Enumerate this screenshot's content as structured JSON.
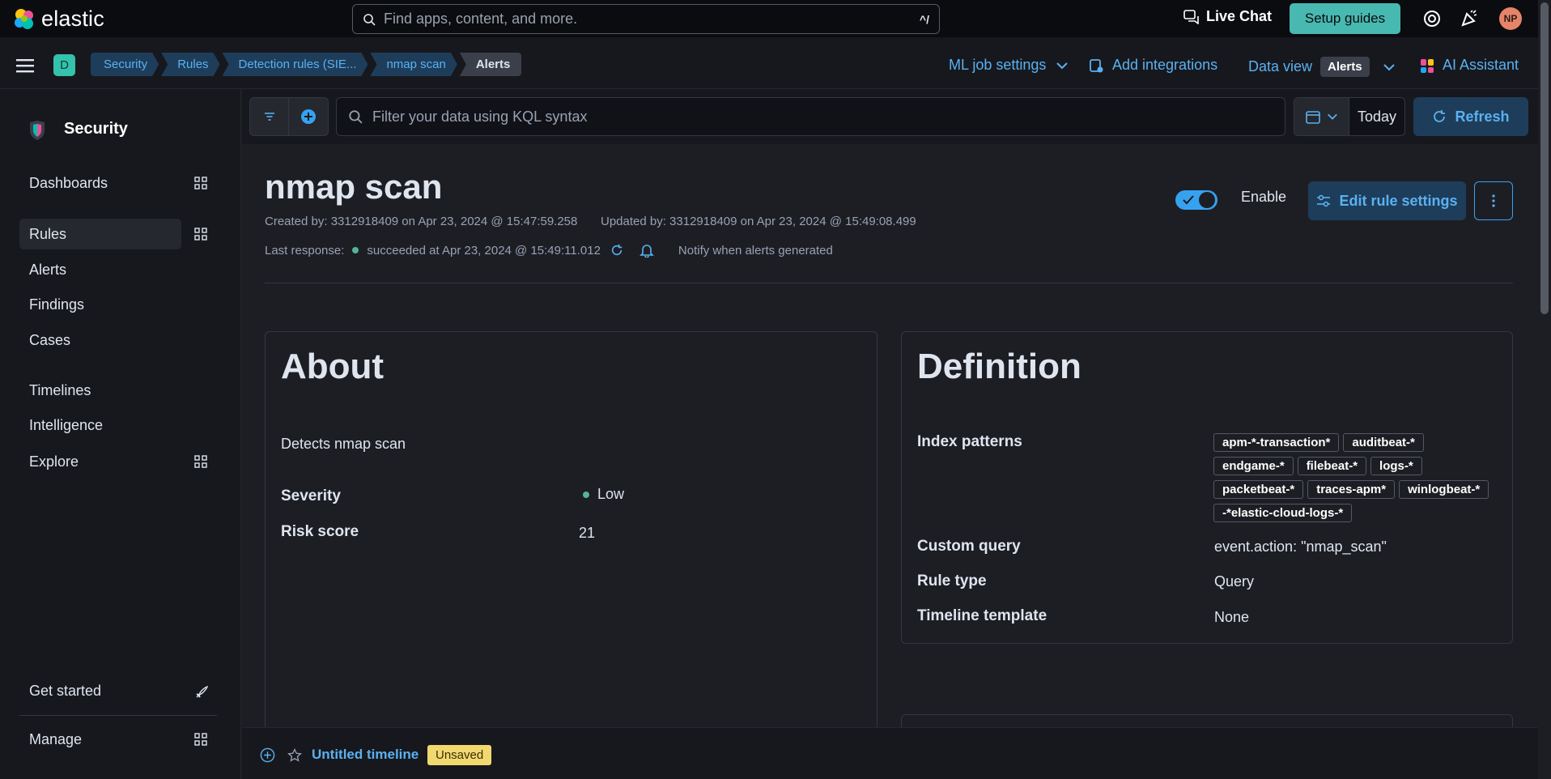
{
  "topbar": {
    "logo_text": "elastic",
    "search_placeholder": "Find apps, content, and more.",
    "search_shortcut": "^/",
    "live_chat": "Live Chat",
    "setup_guides": "Setup guides",
    "avatar_initials": "NP"
  },
  "breadcrumbs": [
    "Security",
    "Rules",
    "Detection rules (SIE...",
    "nmap scan",
    "Alerts"
  ],
  "space_badge": "D",
  "header_actions": {
    "ml_job_settings": "ML job settings",
    "add_integrations": "Add integrations",
    "data_view_label": "Data view",
    "data_view_value": "Alerts",
    "ai_assistant": "AI Assistant"
  },
  "sidebar": {
    "title": "Security",
    "items": {
      "dashboards": "Dashboards",
      "rules": "Rules",
      "alerts": "Alerts",
      "findings": "Findings",
      "cases": "Cases",
      "timelines": "Timelines",
      "intelligence": "Intelligence",
      "explore": "Explore",
      "get_started": "Get started",
      "manage": "Manage"
    }
  },
  "querybar": {
    "placeholder": "Filter your data using KQL syntax",
    "date": "Today",
    "refresh": "Refresh"
  },
  "rule": {
    "title": "nmap scan",
    "created": "Created by: 3312918409 on Apr 23, 2024 @ 15:47:59.258",
    "updated": "Updated by: 3312918409 on Apr 23, 2024 @ 15:49:08.499",
    "last_response_label": "Last response:",
    "last_response_value": "succeeded at Apr 23, 2024 @ 15:49:11.012",
    "notify": "Notify when alerts generated",
    "enable_label": "Enable",
    "enabled": true,
    "edit_button": "Edit rule settings"
  },
  "about": {
    "title": "About",
    "description": "Detects nmap scan",
    "severity_label": "Severity",
    "severity_value": "Low",
    "severity_color": "#54b399",
    "risk_label": "Risk score",
    "risk_value": "21"
  },
  "definition": {
    "title": "Definition",
    "index_label": "Index patterns",
    "index_patterns": [
      "apm-*-transaction*",
      "auditbeat-*",
      "endgame-*",
      "filebeat-*",
      "logs-*",
      "packetbeat-*",
      "traces-apm*",
      "winlogbeat-*",
      "-*elastic-cloud-logs-*"
    ],
    "query_label": "Custom query",
    "query_value": "event.action: \"nmap_scan\"",
    "type_label": "Rule type",
    "type_value": "Query",
    "template_label": "Timeline template",
    "template_value": "None"
  },
  "timeline": {
    "name": "Untitled timeline",
    "status": "Unsaved"
  },
  "colors": {
    "accent": "#36a2ef",
    "link": "#5ab1f1",
    "setup_bg": "#48b9b0",
    "success": "#54b399"
  }
}
